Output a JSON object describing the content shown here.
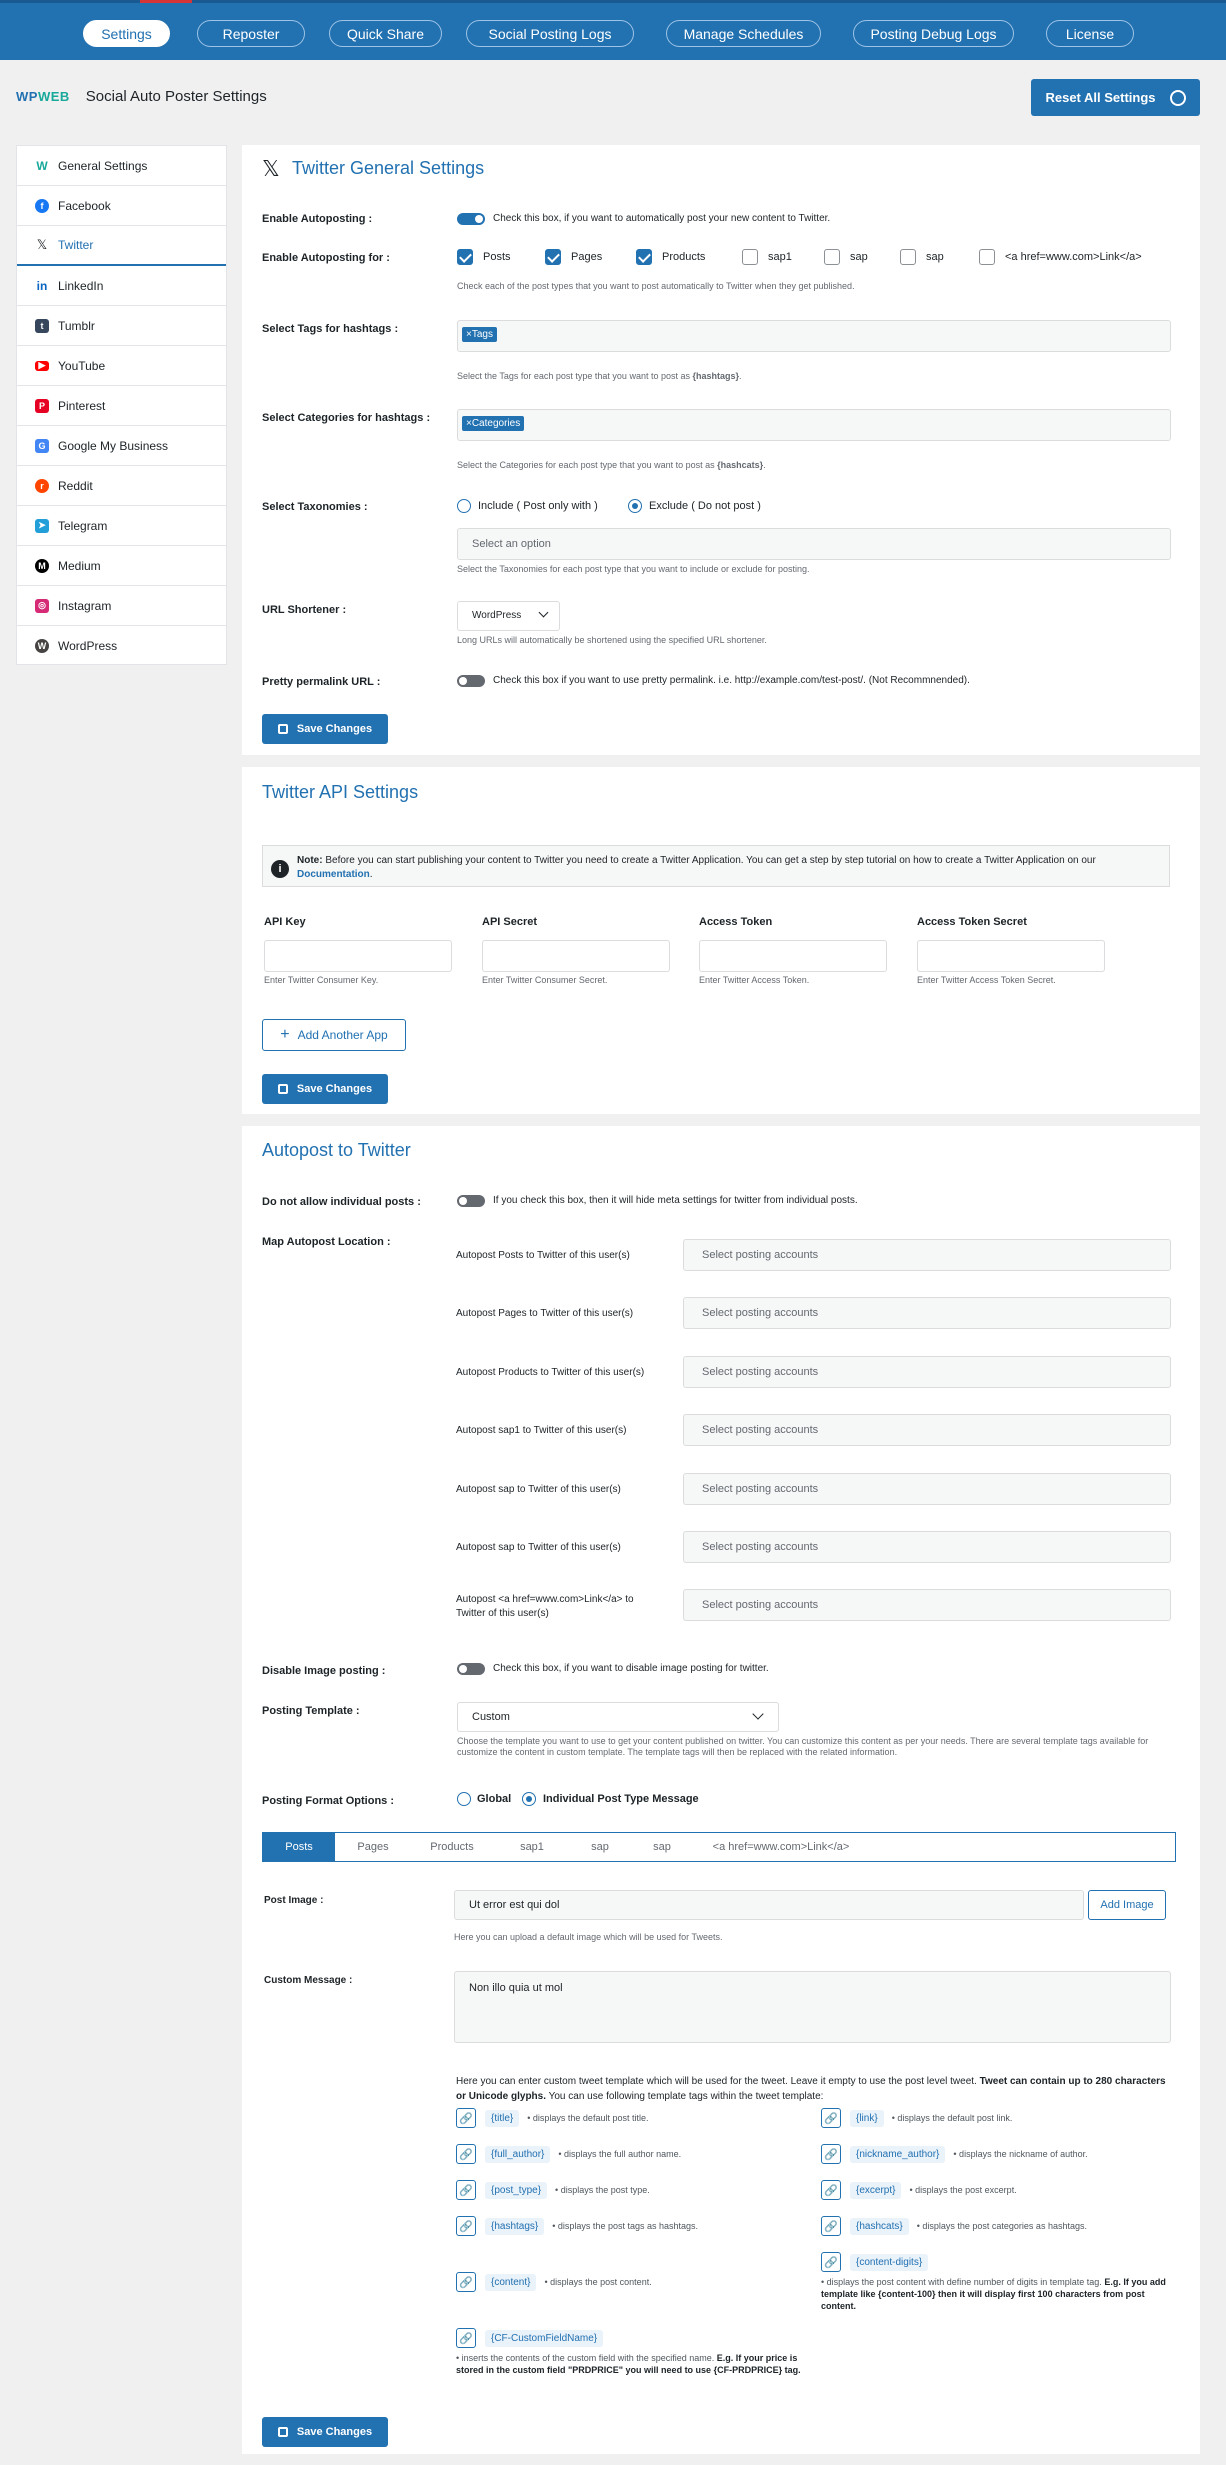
{
  "topnav": {
    "items": [
      {
        "label": "Settings",
        "active": true
      },
      {
        "label": "Reposter",
        "active": false
      },
      {
        "label": "Quick Share",
        "active": false
      },
      {
        "label": "Social Posting Logs",
        "active": false
      },
      {
        "label": "Manage Schedules",
        "active": false
      },
      {
        "label": "Posting Debug Logs",
        "active": false
      },
      {
        "label": "License",
        "active": false
      }
    ]
  },
  "header": {
    "logo_wp": "WP",
    "logo_web": "WEB",
    "title": "Social Auto Poster Settings",
    "reset_label": "Reset All Settings"
  },
  "sidebar": {
    "items": [
      {
        "label": "General Settings",
        "icon": "wpweb-icon"
      },
      {
        "label": "Facebook",
        "icon": "facebook-icon"
      },
      {
        "label": "Twitter",
        "icon": "x-icon",
        "active": true
      },
      {
        "label": "LinkedIn",
        "icon": "linkedin-icon"
      },
      {
        "label": "Tumblr",
        "icon": "tumblr-icon"
      },
      {
        "label": "YouTube",
        "icon": "youtube-icon"
      },
      {
        "label": "Pinterest",
        "icon": "pinterest-icon"
      },
      {
        "label": "Google My Business",
        "icon": "google-my-business-icon"
      },
      {
        "label": "Reddit",
        "icon": "reddit-icon"
      },
      {
        "label": "Telegram",
        "icon": "telegram-icon"
      },
      {
        "label": "Medium",
        "icon": "medium-icon"
      },
      {
        "label": "Instagram",
        "icon": "instagram-icon"
      },
      {
        "label": "WordPress",
        "icon": "wordpress-icon"
      }
    ]
  },
  "general": {
    "title": "Twitter General Settings",
    "enable_autoposting": {
      "label": "Enable Autoposting :",
      "text": "Check this box, if you want to automatically post your new content to Twitter.",
      "checked": true
    },
    "enable_for": {
      "label": "Enable Autoposting for :",
      "options": [
        {
          "label": "Posts",
          "checked": true
        },
        {
          "label": "Pages",
          "checked": true
        },
        {
          "label": "Products",
          "checked": true
        },
        {
          "label": "sap1",
          "checked": false
        },
        {
          "label": "sap",
          "checked": false
        },
        {
          "label": "sap",
          "checked": false
        },
        {
          "label": "<a href=www.com>Link</a>",
          "checked": false
        }
      ],
      "desc": "Check each of the post types that you want to post automatically to Twitter when they get published."
    },
    "tags": {
      "label": "Select Tags for hashtags :",
      "chip": "×Tags",
      "desc_pre": "Select the Tags for each post type that you want to post as ",
      "desc_b": "{hashtags}",
      "desc_post": "."
    },
    "cats": {
      "label": "Select Categories for hashtags :",
      "chip": "×Categories",
      "desc_pre": "Select the Categories for each post type that you want to post as ",
      "desc_b": "{hashcats}",
      "desc_post": "."
    },
    "taxonomies": {
      "label": "Select Taxonomies :",
      "include": "Include ( Post only with )",
      "exclude": "Exclude ( Do not post )",
      "placeholder": "Select an option",
      "desc": "Select the Taxonomies for each post type that you want to include or exclude for posting."
    },
    "shortener": {
      "label": "URL Shortener :",
      "value": "WordPress",
      "desc": "Long URLs will automatically be shortened using the specified URL shortener."
    },
    "permalink": {
      "label": "Pretty permalink URL :",
      "text": "Check this box if you want to use pretty permalink. i.e. http://example.com/test-post/. (Not Recommnended).",
      "checked": false
    },
    "save": "Save Changes"
  },
  "api": {
    "title": "Twitter API Settings",
    "note_b": "Note:",
    "note_text": " Before you can start publishing your content to Twitter you need to create a Twitter Application. You can get a step by step tutorial on how to create a Twitter Application on our ",
    "note_link": "Documentation",
    "note_end": ".",
    "fields": [
      {
        "label": "API Key",
        "desc": "Enter Twitter Consumer Key."
      },
      {
        "label": "API Secret",
        "desc": "Enter Twitter Consumer Secret."
      },
      {
        "label": "Access Token",
        "desc": "Enter Twitter Access Token."
      },
      {
        "label": "Access Token Secret",
        "desc": "Enter Twitter Access Token Secret."
      }
    ],
    "add_app": "Add Another App",
    "save": "Save Changes"
  },
  "autopost": {
    "title": "Autopost to Twitter",
    "no_individual": {
      "label": "Do not allow individual posts :",
      "text": "If you check this box, then it will hide meta settings for twitter from individual posts.",
      "checked": false
    },
    "map_label": "Map Autopost Location :",
    "map_rows": [
      {
        "label": "Autopost Posts to Twitter of this user(s)",
        "placeholder": "Select posting accounts"
      },
      {
        "label": "Autopost Pages to Twitter of this user(s)",
        "placeholder": "Select posting accounts"
      },
      {
        "label": "Autopost Products to Twitter of this user(s)",
        "placeholder": "Select posting accounts"
      },
      {
        "label": "Autopost sap1 to Twitter of this user(s)",
        "placeholder": "Select posting accounts"
      },
      {
        "label": "Autopost sap to Twitter of this user(s)",
        "placeholder": "Select posting accounts"
      },
      {
        "label": "Autopost sap to Twitter of this user(s)",
        "placeholder": "Select posting accounts"
      },
      {
        "label": "Autopost <a href=www.com>Link</a> to Twitter of this user(s)",
        "placeholder": "Select posting accounts"
      }
    ],
    "disable_image": {
      "label": "Disable Image posting :",
      "text": "Check this box, if you want to disable image posting for twitter.",
      "checked": false
    },
    "template": {
      "label": "Posting Template :",
      "value": "Custom",
      "desc": "Choose the template you want to use to get your content published on twitter. You can customize this content as per your needs. There are several template tags available for customize the content in custom template. The template tags will then be replaced with the related information."
    },
    "format": {
      "label": "Posting Format Options :",
      "global": "Global",
      "individual": "Individual Post Type Message"
    },
    "tabs": [
      "Posts",
      "Pages",
      "Products",
      "sap1",
      "sap",
      "sap",
      "<a href=www.com>Link</a>"
    ],
    "post_image": {
      "label": "Post Image :",
      "value": "Ut error est qui dol",
      "add": "Add Image",
      "desc": "Here you can upload a default image which will be used for Tweets."
    },
    "custom_message": {
      "label": "Custom Message :",
      "value": "Non illo quia ut mol"
    },
    "help_pre": "Here you can enter custom tweet template which will be used for the tweet. Leave it empty to use the post level tweet. ",
    "help_b": "Tweet can contain up to 280 characters or Unicode glyphs.",
    "help_post": " You can use following template tags within the tweet template:",
    "tags_left": [
      {
        "tag": "{title}",
        "desc": "• displays the default post title."
      },
      {
        "tag": "{full_author}",
        "desc": "• displays the full author name."
      },
      {
        "tag": "{post_type}",
        "desc": "• displays the post type."
      },
      {
        "tag": "{hashtags}",
        "desc": "• displays the post tags as hashtags."
      },
      {
        "tag": "{content}",
        "desc": "• displays the post content."
      }
    ],
    "tags_right": [
      {
        "tag": "{link}",
        "desc": "• displays the default post link."
      },
      {
        "tag": "{nickname_author}",
        "desc": "• displays the nickname of author."
      },
      {
        "tag": "{excerpt}",
        "desc": "• displays the post excerpt."
      },
      {
        "tag": "{hashcats}",
        "desc": "• displays the post categories as hashtags."
      }
    ],
    "content_digits": {
      "tag": "{content-digits}",
      "desc_pre": "• displays the post content with define number of digits in template tag. ",
      "desc_b": "E.g. If you add template like {content-100} then it will display first 100 characters from post content."
    },
    "cf": {
      "tag": "{CF-CustomFieldName}",
      "desc_pre": "• inserts the contents of the custom field with the specified name. ",
      "desc_b": "E.g. If your price is stored in the custom field \"PRDPRICE\" you will need to use {CF-PRDPRICE} tag."
    },
    "save": "Save Changes"
  }
}
